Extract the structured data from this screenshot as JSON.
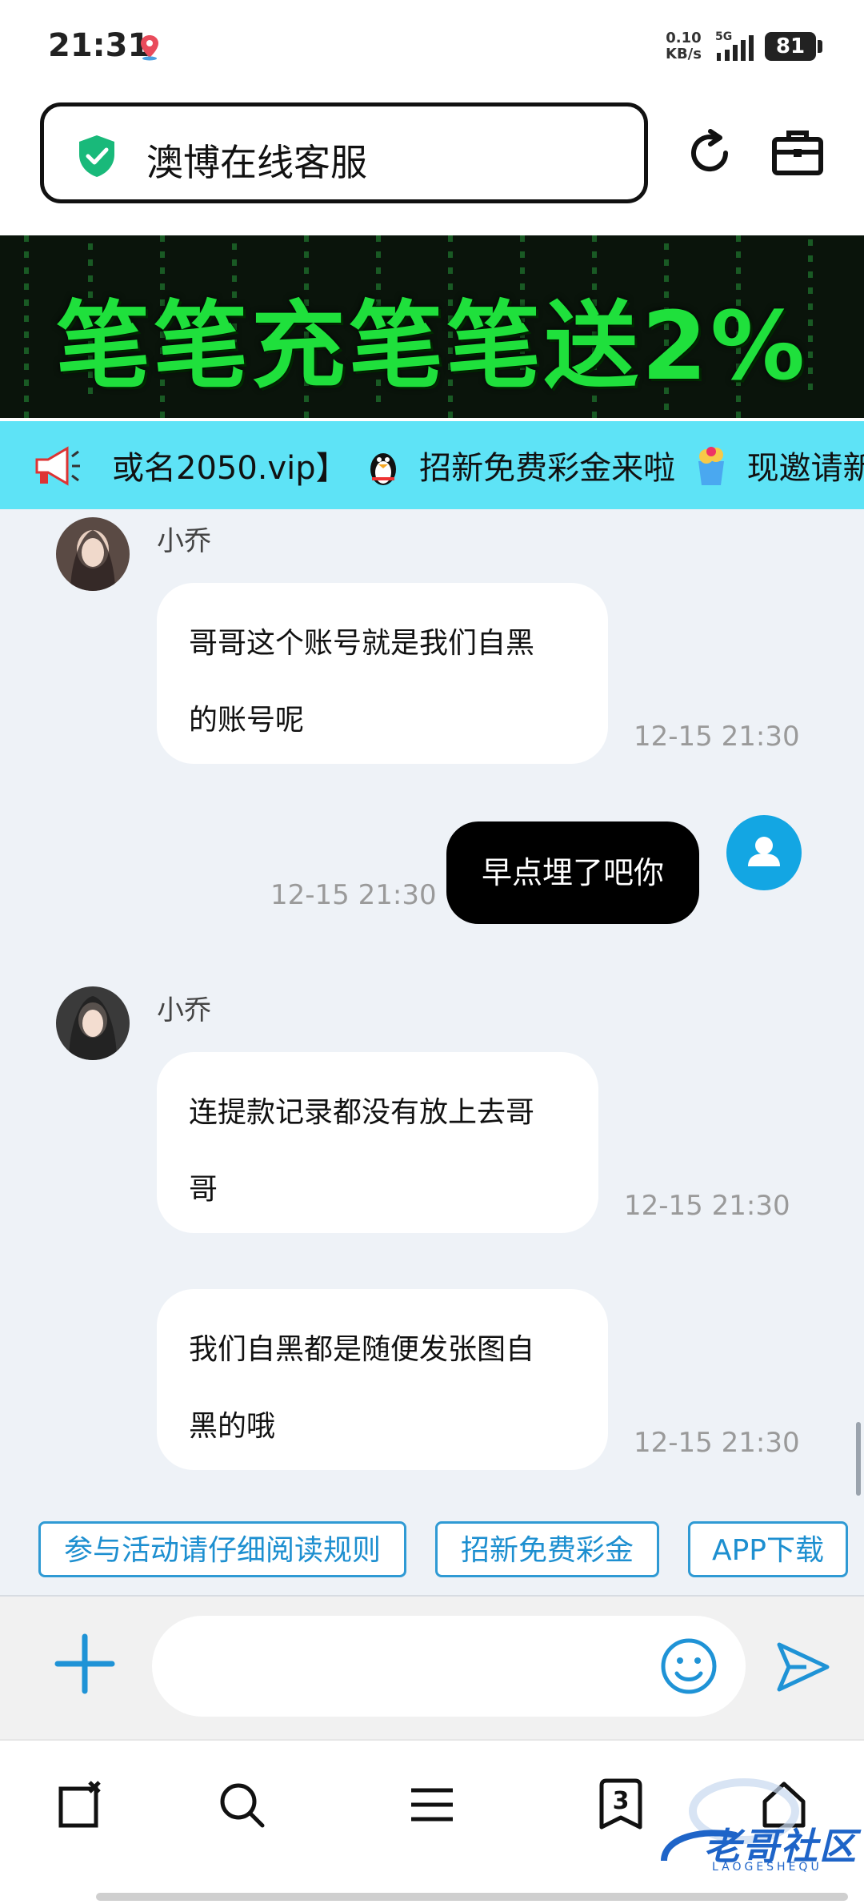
{
  "status_bar": {
    "time": "21:31",
    "net_speed_value": "0.10",
    "net_speed_unit": "KB/s",
    "network": "5G",
    "battery": "81"
  },
  "browser": {
    "title": "澳博在线客服"
  },
  "banner": {
    "text": "笔笔充笔笔送2%"
  },
  "marquee": {
    "text_part1": "或名2050.vip】",
    "text_part2": "招新免费彩金来啦",
    "text_part3": "现邀请新用"
  },
  "chat": {
    "messages": [
      {
        "sender": "小乔",
        "lines": [
          "哥哥这个账号就是我们自黑",
          "的账号呢"
        ],
        "time": "12-15 21:30"
      },
      {
        "sender": "me",
        "text": "早点埋了吧你",
        "time": "12-15 21:30"
      },
      {
        "sender": "小乔",
        "lines": [
          "连提款记录都没有放上去哥",
          "哥"
        ],
        "time": "12-15 21:30"
      },
      {
        "sender": "小乔",
        "lines": [
          "我们自黑都是随便发张图自",
          "黑的哦"
        ],
        "time": "12-15 21:30"
      }
    ]
  },
  "quick_actions": [
    "参与活动请仔细阅读规则",
    "招新免费彩金",
    "APP下载"
  ],
  "input": {
    "placeholder": ""
  },
  "bottom_nav": {
    "tab_count": "3"
  },
  "watermark": {
    "text": "老哥社区",
    "sub": "LAOGESHEQU"
  },
  "colors": {
    "marquee_bg": "#5ee3f6",
    "banner_text": "#1fe03c",
    "accent": "#13a6e3",
    "button_border": "#2f9ad4"
  }
}
